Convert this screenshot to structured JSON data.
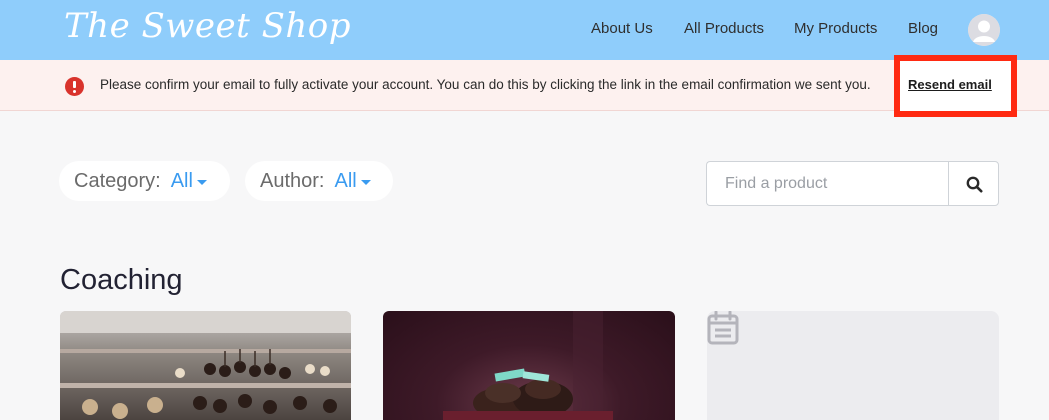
{
  "header": {
    "logo": "The Sweet Shop",
    "nav": [
      "About Us",
      "All Products",
      "My Products",
      "Blog"
    ]
  },
  "banner": {
    "message": "Please confirm your email to fully activate your account. You can do this by clicking the link in the email confirmation we sent you.",
    "resend_label": "Resend email"
  },
  "filters": {
    "category": {
      "label": "Category:",
      "value": "All"
    },
    "author": {
      "label": "Author:",
      "value": "All"
    }
  },
  "search": {
    "placeholder": "Find a product"
  },
  "section": {
    "title": "Coaching"
  },
  "colors": {
    "header_bg": "#8fcdfb",
    "accent": "#3a9bf0",
    "alert": "#d9332c",
    "highlight_box": "#ff2a12"
  }
}
